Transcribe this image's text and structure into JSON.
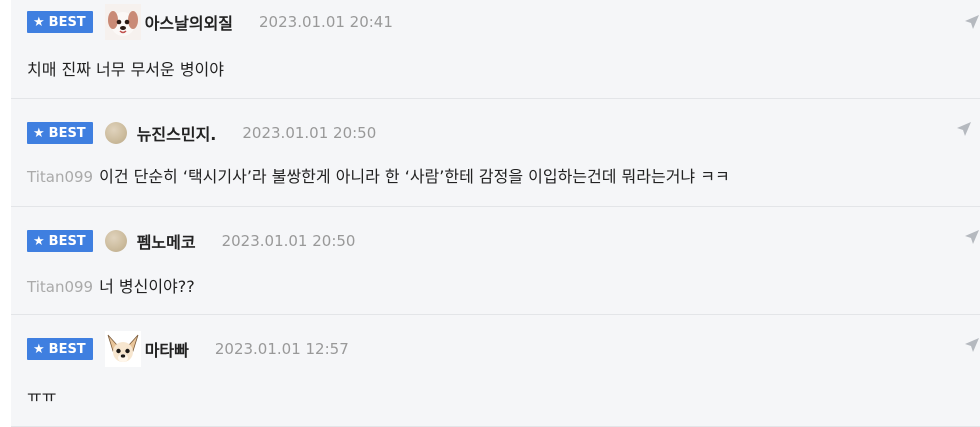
{
  "badge_label": "BEST",
  "comments": [
    {
      "nickname": "아스날의외질",
      "date": "2023.01.01 20:41",
      "reply_to": "",
      "text": "치매 진짜 너무 무서운 병이야",
      "avatar": "puppy-avatar-icon"
    },
    {
      "nickname": "뉴진스민지.",
      "date": "2023.01.01 20:50",
      "reply_to": "Titan099",
      "text": "이건 단순히 ‘택시기사’라 불쌍한게 아니라 한 ‘사람’한테 감정을 이입하는건데 뭐라는거냐 ㅋㅋ",
      "avatar": "default-avatar-icon"
    },
    {
      "nickname": "펨노메코",
      "date": "2023.01.01 20:50",
      "reply_to": "Titan099",
      "text": "너 병신이야??",
      "avatar": "default-avatar-icon"
    },
    {
      "nickname": "마타빠",
      "date": "2023.01.01 12:57",
      "reply_to": "",
      "text": "ㅠㅠ",
      "avatar": "chihuahua-avatar-icon"
    }
  ],
  "colors": {
    "badge": "#3f7fe0",
    "row_bg": "#f5f6f8",
    "date": "#999999"
  }
}
